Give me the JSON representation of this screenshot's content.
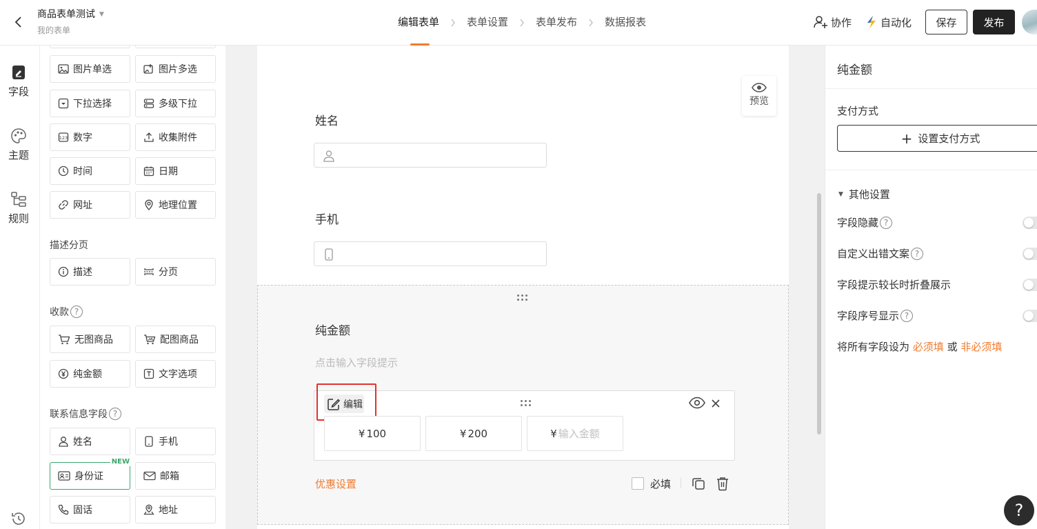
{
  "header": {
    "form_title": "商品表单测试",
    "form_subtitle": "我的表单",
    "steps": [
      "编辑表单",
      "表单设置",
      "表单发布",
      "数据报表"
    ],
    "collab_label": "协作",
    "automation_label": "自动化",
    "save_label": "保存",
    "publish_label": "发布"
  },
  "leftnav": {
    "items": [
      {
        "label": "字段",
        "icon": "field-icon"
      },
      {
        "label": "主题",
        "icon": "palette-icon"
      },
      {
        "label": "规则",
        "icon": "rule-icon"
      }
    ],
    "history_icon": "history-icon"
  },
  "palette": {
    "rows": [
      [
        "图片单选",
        "图片多选"
      ],
      [
        "下拉选择",
        "多级下拉"
      ],
      [
        "数字",
        "收集附件"
      ],
      [
        "时间",
        "日期"
      ],
      [
        "网址",
        "地理位置"
      ]
    ],
    "group_desc": "描述分页",
    "desc_items": [
      "描述",
      "分页"
    ],
    "group_pay": "收款",
    "pay_items": [
      [
        "无图商品",
        "配图商品"
      ],
      [
        "纯金额",
        "文字选项"
      ]
    ],
    "group_contact": "联系信息字段",
    "contact_items": [
      [
        "姓名",
        "手机"
      ],
      [
        "身份证",
        "邮箱"
      ],
      [
        "固话",
        "地址"
      ]
    ],
    "new_tag": "NEW",
    "help_mark": "?"
  },
  "canvas": {
    "preview_label": "预览",
    "q_name": "姓名",
    "q_phone": "手机",
    "q_amount": "纯金额",
    "hint_placeholder": "点击输入字段提示",
    "edit_label": "编辑",
    "currency": "¥",
    "amounts": [
      "100",
      "200"
    ],
    "custom_amount_placeholder": "输入金额",
    "discount_label": "优惠设置",
    "required_label": "必填"
  },
  "rpanel": {
    "title": "纯金额",
    "pay_method_label": "支付方式",
    "pay_button_label": "设置支付方式",
    "other_settings": "其他设置",
    "options": [
      "字段隐藏",
      "自定义出错文案",
      "字段提示较长时折叠展示",
      "字段序号显示"
    ],
    "bulk_prefix": "将所有字段设为",
    "bulk_required": "必须填",
    "bulk_or": "或",
    "bulk_optional": "非必须填"
  },
  "help_label": "?",
  "colors": {
    "accent": "#f07b2f",
    "highlight_border": "#e42f2f",
    "new_green": "#3aa76d",
    "dark": "#222222"
  }
}
